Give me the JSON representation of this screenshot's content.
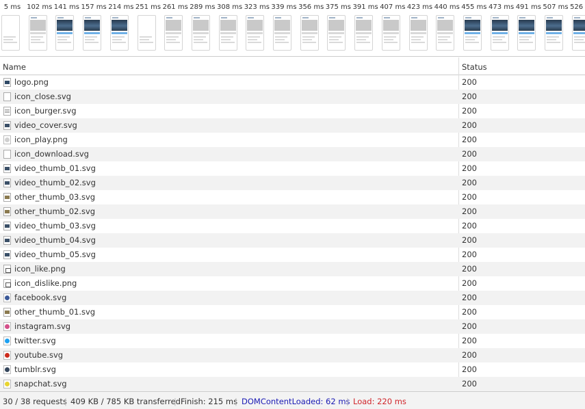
{
  "filmstrip": {
    "frames": [
      {
        "time": "5 ms",
        "kind": "blank"
      },
      {
        "time": "102 ms",
        "kind": "light"
      },
      {
        "time": "141 ms",
        "kind": "full"
      },
      {
        "time": "157 ms",
        "kind": "full"
      },
      {
        "time": "214 ms",
        "kind": "full"
      },
      {
        "time": "251 ms",
        "kind": "blank"
      },
      {
        "time": "261 ms",
        "kind": "light"
      },
      {
        "time": "289 ms",
        "kind": "light"
      },
      {
        "time": "308 ms",
        "kind": "light"
      },
      {
        "time": "323 ms",
        "kind": "light"
      },
      {
        "time": "339 ms",
        "kind": "light"
      },
      {
        "time": "356 ms",
        "kind": "light"
      },
      {
        "time": "375 ms",
        "kind": "light"
      },
      {
        "time": "391 ms",
        "kind": "light"
      },
      {
        "time": "407 ms",
        "kind": "light"
      },
      {
        "time": "423 ms",
        "kind": "light"
      },
      {
        "time": "440 ms",
        "kind": "light"
      },
      {
        "time": "455 ms",
        "kind": "full"
      },
      {
        "time": "473 ms",
        "kind": "full"
      },
      {
        "time": "491 ms",
        "kind": "full"
      },
      {
        "time": "507 ms",
        "kind": "full"
      },
      {
        "time": "526 ms",
        "kind": "full"
      }
    ]
  },
  "table": {
    "headers": {
      "name": "Name",
      "status": "Status"
    },
    "rows": [
      {
        "name": "logo.png",
        "status": "200",
        "icon": "img"
      },
      {
        "name": "icon_close.svg",
        "status": "200",
        "icon": "blank"
      },
      {
        "name": "icon_burger.svg",
        "status": "200",
        "icon": "lines"
      },
      {
        "name": "video_cover.svg",
        "status": "200",
        "icon": "thumb-dark"
      },
      {
        "name": "icon_play.png",
        "status": "200",
        "icon": "circle c-gray"
      },
      {
        "name": "icon_download.svg",
        "status": "200",
        "icon": "blank"
      },
      {
        "name": "video_thumb_01.svg",
        "status": "200",
        "icon": "thumb-dark"
      },
      {
        "name": "video_thumb_02.svg",
        "status": "200",
        "icon": "thumb-dark"
      },
      {
        "name": "other_thumb_03.svg",
        "status": "200",
        "icon": "thumb-warm"
      },
      {
        "name": "other_thumb_02.svg",
        "status": "200",
        "icon": "thumb-warm"
      },
      {
        "name": "video_thumb_03.svg",
        "status": "200",
        "icon": "thumb-dark"
      },
      {
        "name": "video_thumb_04.svg",
        "status": "200",
        "icon": "thumb-dark"
      },
      {
        "name": "video_thumb_05.svg",
        "status": "200",
        "icon": "thumb-dark"
      },
      {
        "name": "icon_like.png",
        "status": "200",
        "icon": "thumbup"
      },
      {
        "name": "icon_dislike.png",
        "status": "200",
        "icon": "thumbup"
      },
      {
        "name": "facebook.svg",
        "status": "200",
        "icon": "circle c-blue"
      },
      {
        "name": "other_thumb_01.svg",
        "status": "200",
        "icon": "thumb-warm"
      },
      {
        "name": "instagram.svg",
        "status": "200",
        "icon": "circle c-pink"
      },
      {
        "name": "twitter.svg",
        "status": "200",
        "icon": "circle c-sky"
      },
      {
        "name": "youtube.svg",
        "status": "200",
        "icon": "circle c-red"
      },
      {
        "name": "tumblr.svg",
        "status": "200",
        "icon": "circle c-navy"
      },
      {
        "name": "snapchat.svg",
        "status": "200",
        "icon": "circle c-yellow"
      }
    ]
  },
  "statusbar": {
    "requests": "30 / 38 requests",
    "transferred": "409 KB / 785 KB transferred",
    "finish": "Finish: 215 ms",
    "dom_content_loaded": "DOMContentLoaded: 62 ms",
    "load": "Load: 220 ms",
    "separator": "|",
    "colors": {
      "dcl": "#1a1ab4",
      "load": "#d0262b",
      "text": "#333333"
    }
  }
}
